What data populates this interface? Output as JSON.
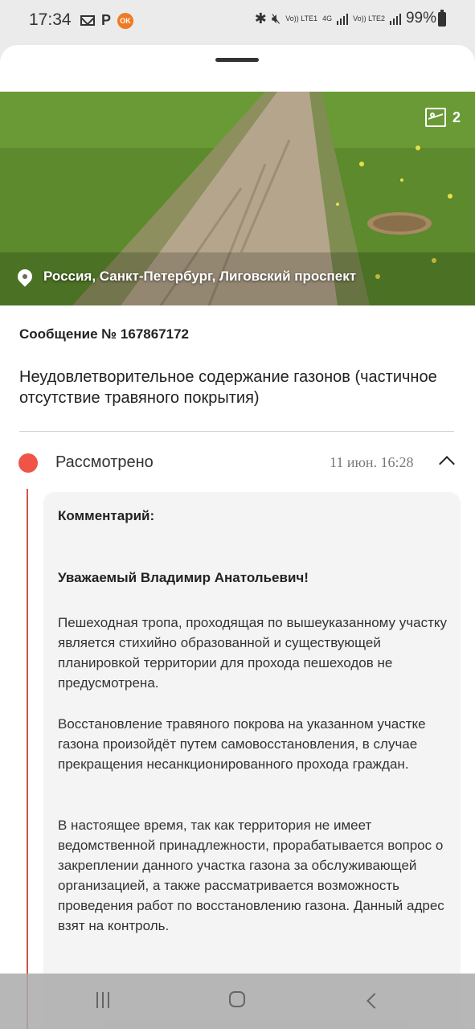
{
  "status_bar": {
    "time": "17:34",
    "sim1_label": "Vo)) LTE1",
    "network_label": "4G",
    "sim2_label": "Vo)) LTE2",
    "battery": "99%"
  },
  "photo": {
    "gallery_count": "2",
    "location": "Россия, Санкт-Петербург, Лиговский проспект"
  },
  "message": {
    "number": "Сообщение № 167867172",
    "title": "Неудовлетворительное содержание газонов (частичное отсутствие травяного покрытия)"
  },
  "status": {
    "label": "Рассмотрено",
    "date": "11 июн. 16:28",
    "color": "#ef5446"
  },
  "comment": {
    "heading": "Комментарий:",
    "greeting": "Уважаемый Владимир Анатольевич!",
    "paragraphs": [
      "Пешеходная тропа, проходящая по вышеуказанному участку является стихийно образованной и существующей планировкой территории для прохода пешеходов не предусмотрена.",
      "Восстановление травяного покрова на указанном участке газона произойдёт путем самовосстановления, в случае прекращения несанкционированного прохода граждан.",
      "В настоящее время, так как территория не имеет ведомственной принадлежности, прорабатывается вопрос о закреплении данного участка газона за обслуживающей организацией, а также рассматривается возможность проведения работ по восстановлению газона. Данный адрес взят на контроль."
    ]
  }
}
